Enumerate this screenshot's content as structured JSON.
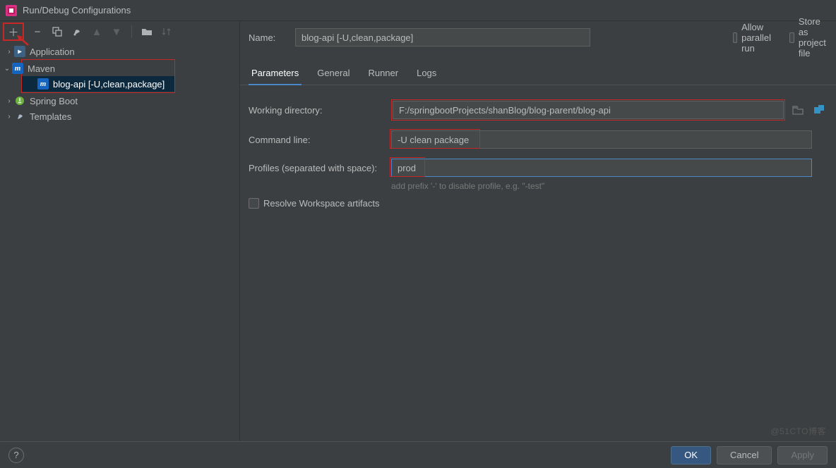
{
  "window": {
    "title": "Run/Debug Configurations"
  },
  "toolbar_icons": {
    "add": "＋",
    "remove": "−",
    "copy": "⿻",
    "wrench": "🔧",
    "up": "▲",
    "down": "▼",
    "folder": "📁",
    "sort": "↕"
  },
  "tree": {
    "items": [
      {
        "label": "Application",
        "icon": "app",
        "expanded": false
      },
      {
        "label": "Maven",
        "icon": "maven",
        "expanded": true,
        "children": [
          {
            "label": "blog-api [-U,clean,package]",
            "icon": "maven"
          }
        ]
      },
      {
        "label": "Spring Boot",
        "icon": "spring",
        "expanded": false
      },
      {
        "label": "Templates",
        "icon": "templates",
        "expanded": false
      }
    ]
  },
  "header": {
    "name_label": "Name:",
    "name_value": "blog-api [-U,clean,package]",
    "allow_parallel": "Allow parallel run",
    "store_project": "Store as project file"
  },
  "tabs": [
    {
      "label": "Parameters",
      "active": true
    },
    {
      "label": "General",
      "active": false
    },
    {
      "label": "Runner",
      "active": false
    },
    {
      "label": "Logs",
      "active": false
    }
  ],
  "form": {
    "working_dir_label": "Working directory:",
    "working_dir_value": "F:/springbootProjects/shanBlog/blog-parent/blog-api",
    "command_line_label": "Command line:",
    "command_line_value": "-U clean package",
    "profiles_label": "Profiles (separated with space):",
    "profiles_value": "prod",
    "profiles_hint": "add prefix '-' to disable profile, e.g. \"-test\"",
    "resolve_artifacts": "Resolve Workspace artifacts"
  },
  "buttons": {
    "ok": "OK",
    "cancel": "Cancel",
    "apply": "Apply",
    "help": "?"
  },
  "watermark": "@51CTO博客"
}
